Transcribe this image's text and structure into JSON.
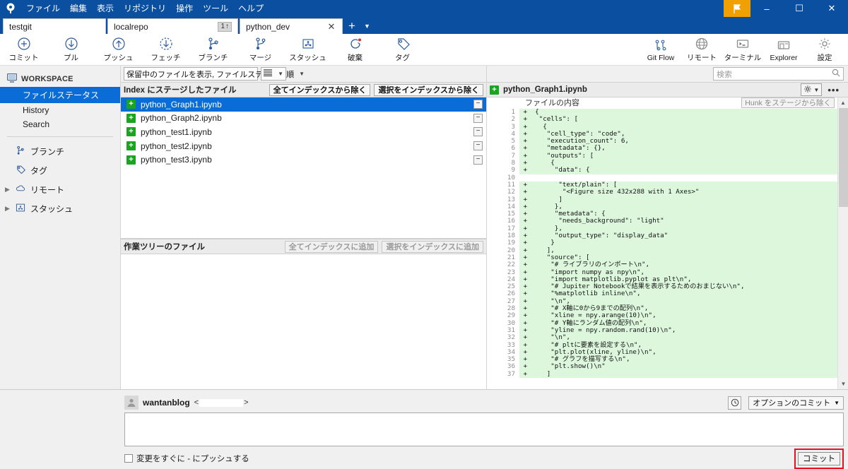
{
  "titlebar": {
    "logo_icon": "sourcetree-logo-icon",
    "menus": [
      "ファイル",
      "編集",
      "表示",
      "リポジトリ",
      "操作",
      "ツール",
      "ヘルプ"
    ],
    "flag_icon": "flag-icon",
    "minimize_icon": "minimize-icon",
    "maximize_icon": "maximize-icon",
    "close_icon": "close-icon",
    "accent_color": "#0a4fa0",
    "flag_color": "#f0a000"
  },
  "tabs": [
    {
      "label": "testgit",
      "badge": "",
      "closable": false,
      "active": false
    },
    {
      "label": "localrepo",
      "badge": "1",
      "badge_icon": "up-arrow-icon",
      "closable": false,
      "active": false
    },
    {
      "label": "python_dev",
      "badge": "",
      "closable": true,
      "active": true
    }
  ],
  "tabbar": {
    "add_label": "+",
    "menu_icon": "chevron-down-icon"
  },
  "toolbar": {
    "left": [
      {
        "label": "コミット",
        "icon": "commit-plus-icon"
      },
      {
        "label": "プル",
        "icon": "pull-down-arrow-icon"
      },
      {
        "label": "プッシュ",
        "icon": "push-up-arrow-icon"
      },
      {
        "label": "フェッチ",
        "icon": "fetch-dashed-arrow-icon"
      },
      {
        "label": "ブランチ",
        "icon": "branch-icon"
      },
      {
        "label": "マージ",
        "icon": "merge-icon"
      },
      {
        "label": "スタッシュ",
        "icon": "stash-icon"
      },
      {
        "label": "破棄",
        "icon": "discard-refresh-icon"
      },
      {
        "label": "タグ",
        "icon": "tag-icon"
      }
    ],
    "right": [
      {
        "label": "Git Flow",
        "icon": "gitflow-icon"
      },
      {
        "label": "リモート",
        "icon": "globe-icon"
      },
      {
        "label": "ターミナル",
        "icon": "terminal-icon"
      },
      {
        "label": "Explorer",
        "icon": "folder-explorer-icon"
      },
      {
        "label": "設定",
        "icon": "gear-icon"
      }
    ]
  },
  "sidebar": {
    "workspace": {
      "label": "WORKSPACE",
      "icon": "monitor-icon"
    },
    "workspace_items": [
      {
        "label": "ファイルステータス",
        "active": true
      },
      {
        "label": "History",
        "active": false
      },
      {
        "label": "Search",
        "active": false
      }
    ],
    "sections": [
      {
        "label": "ブランチ",
        "icon": "branch-icon",
        "expandable": false
      },
      {
        "label": "タグ",
        "icon": "tag-icon",
        "expandable": false
      },
      {
        "label": "リモート",
        "icon": "cloud-icon",
        "expandable": true
      },
      {
        "label": "スタッシュ",
        "icon": "stash-icon",
        "expandable": true
      }
    ]
  },
  "center": {
    "filter": {
      "value": "保留中のファイルを表示, ファイルステータス順",
      "caret_icon": "chevron-down-icon"
    },
    "view_mode": {
      "icon": "list-lines-icon",
      "caret_icon": "chevron-down-icon"
    },
    "staged": {
      "title": "Index にステージしたファイル",
      "unstage_all_label": "全てインデックスから除く",
      "unstage_selected_label": "選択をインデックスから除く",
      "files": [
        {
          "name": "python_Graph1.ipynb",
          "status": "added",
          "selected": true
        },
        {
          "name": "python_Graph2.ipynb",
          "status": "added",
          "selected": false
        },
        {
          "name": "python_test1.ipynb",
          "status": "added",
          "selected": false
        },
        {
          "name": "python_test2.ipynb",
          "status": "added",
          "selected": false
        },
        {
          "name": "python_test3.ipynb",
          "status": "added",
          "selected": false
        }
      ]
    },
    "worktree": {
      "title": "作業ツリーのファイル",
      "stage_all_label": "全てインデックスに追加",
      "stage_selected_label": "選択をインデックスに追加",
      "files": []
    }
  },
  "right": {
    "search": {
      "placeholder": "検索",
      "value": "",
      "icon": "search-icon"
    },
    "diff_header": {
      "filename": "python_Graph1.ipynb",
      "status_icon": "added-plus-icon",
      "gear_icon": "gear-icon",
      "caret_icon": "chevron-down-icon",
      "more_icon": "ellipsis-icon"
    },
    "content_label": "ファイルの内容",
    "unstage_hunk_label": "Hunk をステージから除く",
    "scrollbar": {
      "up_icon": "scroll-up-arrow-icon",
      "down_icon": "scroll-down-arrow-icon"
    },
    "diff_lines": [
      {
        "n": 1,
        "m": "+",
        "t": "{"
      },
      {
        "n": 2,
        "m": "+",
        "t": " \"cells\": ["
      },
      {
        "n": 3,
        "m": "+",
        "t": "  {"
      },
      {
        "n": 4,
        "m": "+",
        "t": "   \"cell_type\": \"code\","
      },
      {
        "n": 5,
        "m": "+",
        "t": "   \"execution_count\": 6,"
      },
      {
        "n": 6,
        "m": "+",
        "t": "   \"metadata\": {},"
      },
      {
        "n": 7,
        "m": "+",
        "t": "   \"outputs\": ["
      },
      {
        "n": 8,
        "m": "+",
        "t": "    {"
      },
      {
        "n": 9,
        "m": "+",
        "t": "     \"data\": {"
      },
      {
        "n": 10,
        "m": "",
        "t": ""
      },
      {
        "n": 11,
        "m": "+",
        "t": "      \"text/plain\": ["
      },
      {
        "n": 12,
        "m": "+",
        "t": "       \"<Figure size 432x288 with 1 Axes>\""
      },
      {
        "n": 13,
        "m": "+",
        "t": "      ]"
      },
      {
        "n": 14,
        "m": "+",
        "t": "     },"
      },
      {
        "n": 15,
        "m": "+",
        "t": "     \"metadata\": {"
      },
      {
        "n": 16,
        "m": "+",
        "t": "      \"needs_background\": \"light\""
      },
      {
        "n": 17,
        "m": "+",
        "t": "     },"
      },
      {
        "n": 18,
        "m": "+",
        "t": "     \"output_type\": \"display_data\""
      },
      {
        "n": 19,
        "m": "+",
        "t": "    }"
      },
      {
        "n": 20,
        "m": "+",
        "t": "   ],"
      },
      {
        "n": 21,
        "m": "+",
        "t": "   \"source\": ["
      },
      {
        "n": 22,
        "m": "+",
        "t": "    \"# ライブラリのインポート\\n\","
      },
      {
        "n": 23,
        "m": "+",
        "t": "    \"import numpy as npy\\n\","
      },
      {
        "n": 24,
        "m": "+",
        "t": "    \"import matplotlib.pyplot as plt\\n\","
      },
      {
        "n": 25,
        "m": "+",
        "t": "    \"# Jupiter Notebookで結果を表示するためのおまじない\\n\","
      },
      {
        "n": 26,
        "m": "+",
        "t": "    \"%matplotlib inline\\n\","
      },
      {
        "n": 27,
        "m": "+",
        "t": "    \"\\n\","
      },
      {
        "n": 28,
        "m": "+",
        "t": "    \"# X軸に0から9までの配列\\n\","
      },
      {
        "n": 29,
        "m": "+",
        "t": "    \"xline = npy.arange(10)\\n\","
      },
      {
        "n": 30,
        "m": "+",
        "t": "    \"# Y軸にランダム値の配列\\n\","
      },
      {
        "n": 31,
        "m": "+",
        "t": "    \"yline = npy.random.rand(10)\\n\","
      },
      {
        "n": 32,
        "m": "+",
        "t": "    \"\\n\","
      },
      {
        "n": 33,
        "m": "+",
        "t": "    \"# pltに要素を設定する\\n\","
      },
      {
        "n": 34,
        "m": "+",
        "t": "    \"plt.plot(xline, yline)\\n\","
      },
      {
        "n": 35,
        "m": "+",
        "t": "    \"# グラフを描写する\\n\","
      },
      {
        "n": 36,
        "m": "+",
        "t": "    \"plt.show()\\n\""
      },
      {
        "n": 37,
        "m": "+",
        "t": "   ]"
      }
    ]
  },
  "commit": {
    "avatar_icon": "user-avatar-icon",
    "author_name": "wantanblog",
    "email_prefix": "<",
    "email_suffix": ">",
    "history_icon": "clock-history-icon",
    "options_label": "オプションのコミット",
    "options_caret_icon": "chevron-down-icon",
    "message_value": "",
    "push_checkbox_label": "変更をすぐに - にプッシュする",
    "push_checked": false,
    "commit_button_label": "コミット",
    "highlight_color": "#e81123"
  }
}
